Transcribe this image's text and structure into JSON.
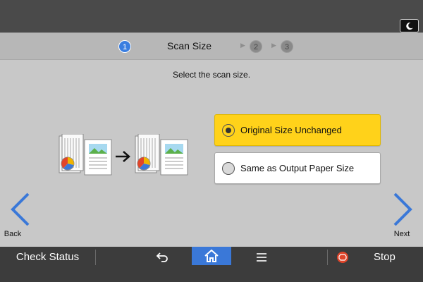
{
  "wizard": {
    "current_step": "1",
    "title": "Scan Size",
    "step2": "2",
    "step3": "3"
  },
  "instruction": "Select the scan size.",
  "options": [
    {
      "label": "Original Size Unchanged",
      "selected": true
    },
    {
      "label": "Same as Output Paper Size",
      "selected": false
    }
  ],
  "nav": {
    "back_label": "Back",
    "next_label": "Next"
  },
  "bottombar": {
    "check_status_label": "Check Status",
    "stop_label": "Stop"
  },
  "icons": {
    "top_right": "moon-icon",
    "back": "chevron-left-icon",
    "next": "chevron-right-icon",
    "return": "return-arrow-icon",
    "home": "home-icon",
    "menu": "hamburger-menu-icon",
    "stop": "stop-icon"
  },
  "colors": {
    "accent_blue": "#3a78d8",
    "selected_option": "#ffd21a",
    "stop_red": "#e0452a"
  }
}
